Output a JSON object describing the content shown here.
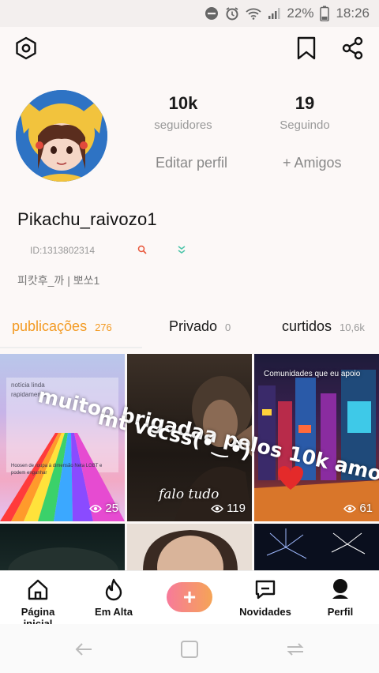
{
  "status": {
    "battery": "22%",
    "time": "18:26"
  },
  "profile": {
    "followers_count": "10k",
    "followers_label": "seguidores",
    "following_count": "19",
    "following_label": "Seguindo",
    "edit_label": "Editar perfil",
    "friends_label": "+ Amigos",
    "username": "Pikachu_raivozo1",
    "id_text": "ID:1313802314",
    "bio": "피캇후_까 | 뽀쏘1"
  },
  "tabs": [
    {
      "label": "publicações",
      "count": "276"
    },
    {
      "label": "Privado",
      "count": "0"
    },
    {
      "label": "curtidos",
      "count": "10,6k"
    }
  ],
  "posts": [
    {
      "views": "25",
      "text_lines": [
        "notícia linda",
        "rapidamente",
        "Hoosen de roupa à dimensão Neta LGBT e",
        "podem enganhar"
      ]
    },
    {
      "views": "119",
      "caption": "falo tudo"
    },
    {
      "views": "61",
      "header": "Comunidades que eu apoio"
    }
  ],
  "overlay": {
    "line1": "muitoo brigadaa pelos 10k amo",
    "line2": "mt vccss(•́‿•̀)"
  },
  "nav": [
    {
      "label": "Página inicial"
    },
    {
      "label": "Em Alta"
    },
    {
      "label": "+"
    },
    {
      "label": "Novidades"
    },
    {
      "label": "Perfil"
    }
  ],
  "colors": {
    "accent": "#f39a22",
    "plus_gradient_start": "#f77a9a",
    "plus_gradient_end": "#f5a456"
  }
}
